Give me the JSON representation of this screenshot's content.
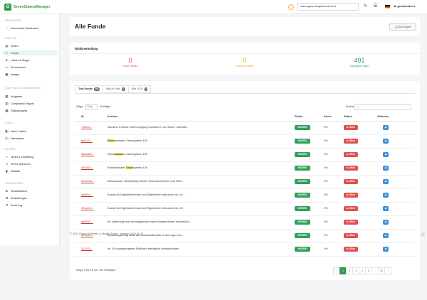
{
  "app": {
    "logo_text": "GreenClaimsManager",
    "logo_mark": "G"
  },
  "topbar": {
    "site_select": "www.agora-energiewende.de/ ▾",
    "user": "greentester ▾",
    "icons": [
      "status-circle-icon",
      "edit-icon",
      "list-icon",
      "flag-de-icon",
      "user-icon"
    ]
  },
  "sidebar": {
    "sections": [
      {
        "title": "DASHBOARD",
        "items": [
          {
            "label": "Greenwash Dashboard",
            "icon": "chart-icon"
          }
        ]
      },
      {
        "title": "ANALYSE",
        "items": [
          {
            "label": "Seiten",
            "icon": "pages-icon"
          },
          {
            "label": "Funde",
            "icon": "search-icon",
            "active": true
          },
          {
            "label": "Labels & Siegel",
            "icon": "label-icon"
          },
          {
            "label": "Screenshots",
            "icon": "screenshot-icon"
          },
          {
            "label": "Images",
            "icon": "image-icon"
          }
        ]
      },
      {
        "title": "COMPLIANCE MANAGEMENT",
        "items": [
          {
            "label": "Aufgaben",
            "icon": "tasks-icon"
          },
          {
            "label": "Compliance-Report",
            "icon": "report-icon"
          },
          {
            "label": "Risikoanalyse",
            "icon": "risk-icon"
          }
        ]
      },
      {
        "title": "INHALT",
        "items": [
          {
            "label": "Neue Claims",
            "icon": "bookmark-icon"
          },
          {
            "label": "Nachweise",
            "icon": "evidence-icon"
          }
        ]
      },
      {
        "title": "WISSEN",
        "items": [
          {
            "label": "Skript & Einbettung",
            "icon": "code-icon"
          },
          {
            "label": "Text & Sprachen",
            "icon": "translate-icon"
          },
          {
            "label": "Statistik",
            "icon": "statistics-icon"
          }
        ]
      },
      {
        "title": "VERWALTUNG",
        "items": [
          {
            "label": "Textbausteine",
            "icon": "textblock-icon"
          },
          {
            "label": "Einstellungen",
            "icon": "gear-icon"
          },
          {
            "label": "Audit-Log",
            "icon": "history-icon"
          }
        ]
      }
    ]
  },
  "page": {
    "title": "Alle Funde",
    "csv_button": "⤓ CSV-Export"
  },
  "risk": {
    "title": "Risikoverteilung",
    "items": [
      {
        "value": "0",
        "label": "Hohes Risiko",
        "color": "#e04848"
      },
      {
        "value": "0",
        "label": "Mittleres Risiko",
        "color": "#f0a020"
      },
      {
        "value": "491",
        "label": "Niedriges Risiko",
        "color": "#2ea05a"
      }
    ]
  },
  "tabs": [
    {
      "label": "Text-Funde",
      "count": "491",
      "active": true
    },
    {
      "label": "Bild Alt-Text",
      "count": "0"
    },
    {
      "label": "Bild OCR",
      "count": "0"
    }
  ],
  "controls": {
    "show_label": "Zeige",
    "page_size": "10 ▾",
    "entries_label": "Einträge",
    "search_label": "Suche:",
    "search_icon": "⌕"
  },
  "table": {
    "headers": [
      "ID",
      "Kontext",
      "Risiko",
      "Score",
      "Status",
      "Aktionen"
    ],
    "rows": [
      {
        "id": "7f4fc33...",
        "pre": "Industrie in Netze und Erzeugung investieren, um Strom- und Wär...",
        "hl": "",
        "post": "",
        "risk": "NIEDRIG",
        "score": "0%",
        "status": "⊗ Offen"
      },
      {
        "id": "f8d31f7...",
        "pre": "",
        "hl": "Klima",
        "post": "neutrales Stromsystem 428",
        "risk": "NIEDRIG",
        "score": "0%",
        "status": "⊗ Offen"
      },
      {
        "id": "5556b89...",
        "pre": "Klima",
        "hl": "neutral",
        "post": "es Stromsystem 428",
        "risk": "NIEDRIG",
        "score": "0%",
        "status": "⊗ Offen"
      },
      {
        "id": "4f5182d...",
        "pre": "Klimaneutrales ",
        "hl": "Strom",
        "post": "system 428",
        "risk": "NIEDRIG",
        "score": "0%",
        "status": "⊗ Offen"
      },
      {
        "id": "e34dee8...",
        "pre": "Klimaneutral. Gleichzeitig werden Verbraucherinnen und Verbr...",
        "hl": "",
        "post": "",
        "risk": "NIEDRIG",
        "score": "0%",
        "status": "⊗ Offen"
      },
      {
        "id": "3def4b1...",
        "pre": "Kosten für Eigentümerinnen und Eigentümer verbunden ist. „Kl...",
        "hl": "",
        "post": "",
        "risk": "NIEDRIG",
        "score": "0%",
        "status": "⊗ Offen"
      },
      {
        "id": "47ac431...",
        "pre": "Kosten für Eigentümerinnen und Eigentümer verbunden ist. „Kl...",
        "hl": "",
        "post": "",
        "risk": "NIEDRIG",
        "score": "0%",
        "status": "⊗ Offen"
      },
      {
        "id": "d68f9c2...",
        "pre": "für Sanierung und Heizungstausch reicht Klimaneutrales erforderlich...",
        "hl": "",
        "post": "",
        "risk": "NIEDRIG",
        "score": "0%",
        "status": "⊗ Offen"
      },
      {
        "id": "a72b6f1...",
        "pre": "Bundesregierung sollte alle Hausbesitzenden in die Lage vers...",
        "hl": "",
        "post": "",
        "risk": "NIEDRIG",
        "score": "0%",
        "status": "⊗ Offen"
      },
      {
        "id": "3237f2f...",
        "pre": "ist. „Ein ausgewogener Politikmix ermöglicht klimaneutrales ...",
        "hl": "",
        "post": "",
        "risk": "NIEDRIG",
        "score": "0%",
        "status": "⊗ Offen"
      }
    ]
  },
  "footer": {
    "info": "Zeige 1 bis 10 von 491 Einträgen",
    "pages": [
      "‹",
      "1",
      "2",
      "3",
      "4",
      "5",
      "…",
      "50",
      "›"
    ],
    "copyright": "© 2024 Papoo Software & Media GmbH - Version 2025.11.20"
  },
  "colors": {
    "brand": "#2e9e4e",
    "danger": "#e05050",
    "action": "#3a8fd8"
  }
}
